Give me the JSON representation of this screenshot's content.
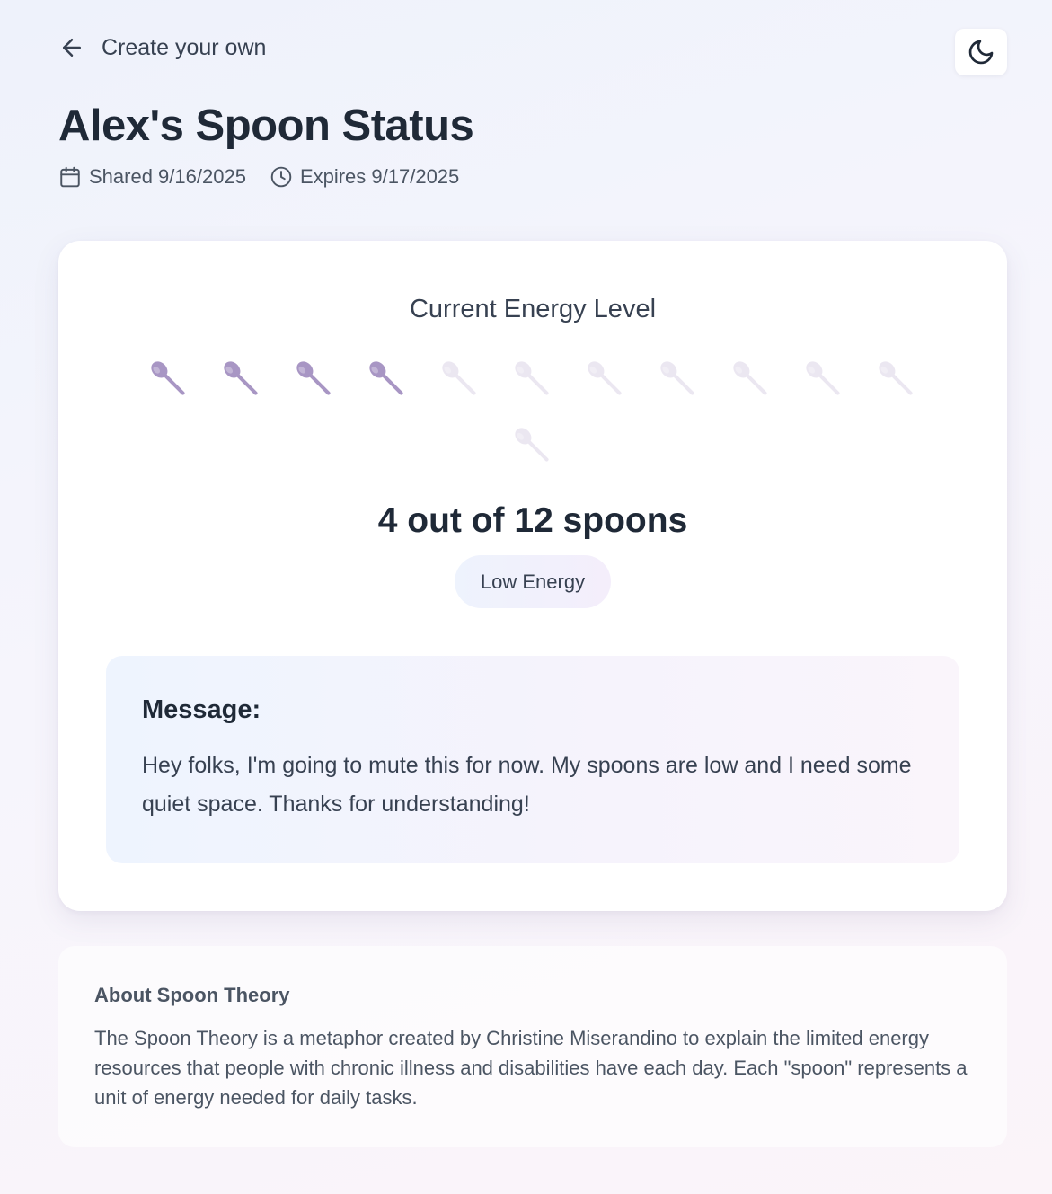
{
  "nav": {
    "back_label": "Create your own"
  },
  "page": {
    "title": "Alex's Spoon Status",
    "shared": "Shared 9/16/2025",
    "expires": "Expires 9/17/2025"
  },
  "energy": {
    "heading": "Current Energy Level",
    "spoons_filled": 4,
    "spoons_total": 12,
    "count_text": "4 out of 12 spoons",
    "badge": "Low Energy",
    "spoon_color_filled": "#a896c4"
  },
  "message": {
    "label": "Message:",
    "text": "Hey folks, I'm going to mute this for now. My spoons are low and I need some quiet space. Thanks for understanding!"
  },
  "about": {
    "title": "About Spoon Theory",
    "text": "The Spoon Theory is a metaphor created by Christine Miserandino to explain the limited energy resources that people with chronic illness and disabilities have each day. Each \"spoon\" represents a unit of energy needed for daily tasks."
  },
  "icons": {
    "back": "arrow-left-icon",
    "theme": "moon-icon",
    "shared": "calendar-icon",
    "expires": "clock-icon",
    "spoon": "spoon-icon"
  }
}
